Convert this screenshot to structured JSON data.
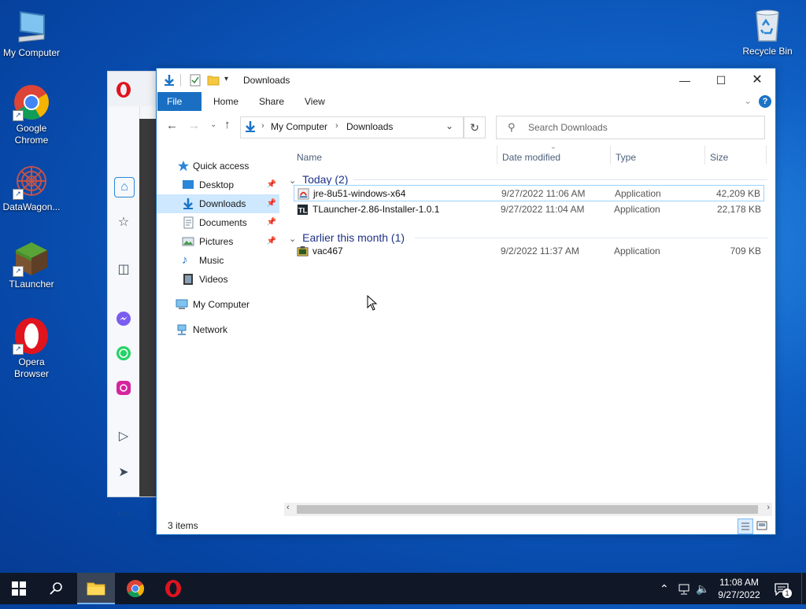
{
  "desktop": {
    "icons": [
      {
        "label": "My Computer"
      },
      {
        "label": "Google Chrome"
      },
      {
        "label": "DataWagon..."
      },
      {
        "label": "TLauncher"
      },
      {
        "label": "Opera Browser"
      },
      {
        "label": "Recycle Bin"
      }
    ]
  },
  "opera": {
    "sidebar_icons": [
      "home-icon",
      "star-icon",
      "bag-icon",
      "messenger-icon",
      "whatsapp-icon",
      "instagram-icon",
      "play-icon",
      "send-icon",
      "more-icon"
    ],
    "more_label": "···"
  },
  "explorer": {
    "title": "Downloads",
    "ribbon_tabs": [
      "File",
      "Home",
      "Share",
      "View"
    ],
    "address": {
      "root": "My Computer",
      "current": "Downloads"
    },
    "search_placeholder": "Search Downloads",
    "nav": {
      "quick_access": "Quick access",
      "items": [
        "Desktop",
        "Downloads",
        "Documents",
        "Pictures",
        "Music",
        "Videos"
      ],
      "my_computer": "My Computer",
      "network": "Network"
    },
    "columns": {
      "name": "Name",
      "date": "Date modified",
      "type": "Type",
      "size": "Size"
    },
    "groups": [
      {
        "header": "Today (2)",
        "files": [
          {
            "name": "jre-8u51-windows-x64",
            "date": "9/27/2022 11:06 AM",
            "type": "Application",
            "size": "42,209 KB"
          },
          {
            "name": "TLauncher-2.86-Installer-1.0.1",
            "date": "9/27/2022 11:04 AM",
            "type": "Application",
            "size": "22,178 KB"
          }
        ]
      },
      {
        "header": "Earlier this month (1)",
        "files": [
          {
            "name": "vac467",
            "date": "9/2/2022 11:37 AM",
            "type": "Application",
            "size": "709 KB"
          }
        ]
      }
    ],
    "status": "3 items"
  },
  "taskbar": {
    "time": "11:08 AM",
    "date": "9/27/2022",
    "notification_count": "1"
  },
  "colors": {
    "accent": "#1a6fc2",
    "taskbar": "#101828",
    "selection": "#cde8ff"
  }
}
